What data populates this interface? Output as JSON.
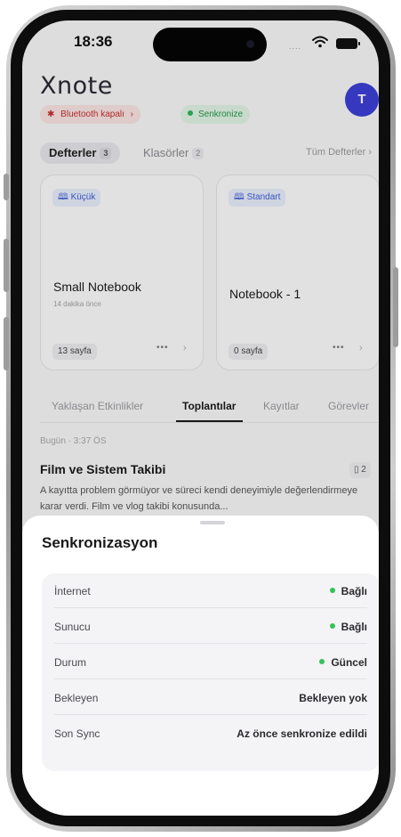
{
  "status_bar": {
    "time": "18:36",
    "signal": "...."
  },
  "app": {
    "logo": "Xnote",
    "avatar_initial": "T"
  },
  "badges": {
    "bluetooth": "Bluetooth kapalı",
    "sync": "Senkronize"
  },
  "segments": {
    "notebooks_label": "Defterler",
    "notebooks_count": "3",
    "folders_label": "Klasörler",
    "folders_count": "2",
    "all_link": "Tüm Defterler"
  },
  "cards": [
    {
      "tag": "Küçük",
      "title": "Small Notebook",
      "subtitle": "14 dakika önce",
      "pages": "13 sayfa"
    },
    {
      "tag": "Standart",
      "title": "Notebook - 1",
      "subtitle": "",
      "pages": "0 sayfa"
    }
  ],
  "tabs": [
    "Yaklaşan Etkinlikler",
    "Toplantılar",
    "Kayıtlar",
    "Görevler"
  ],
  "active_tab": "Toplantılar",
  "meeting": {
    "date": "Bugün · 3:37 ÖS",
    "title": "Film ve Sistem Takibi",
    "count": "2",
    "body": "A kayıtta problem görmüyor ve süreci kendi deneyimiyle değerlendirmeye karar verdi. Film ve vlog takibi konusunda..."
  },
  "sheet": {
    "title": "Senkronizasyon",
    "rows": [
      {
        "label": "İnternet",
        "value": "Bağlı"
      },
      {
        "label": "Sunucu",
        "value": "Bağlı"
      },
      {
        "label": "Durum",
        "value": "Güncel"
      },
      {
        "label": "Bekleyen",
        "value": "Bekleyen yok"
      },
      {
        "label": "Son Sync",
        "value": "Az önce senkronize edildi"
      }
    ]
  },
  "colors": {
    "accent": "#3d3fd6",
    "success": "#34c25a",
    "danger": "#c0332e"
  }
}
